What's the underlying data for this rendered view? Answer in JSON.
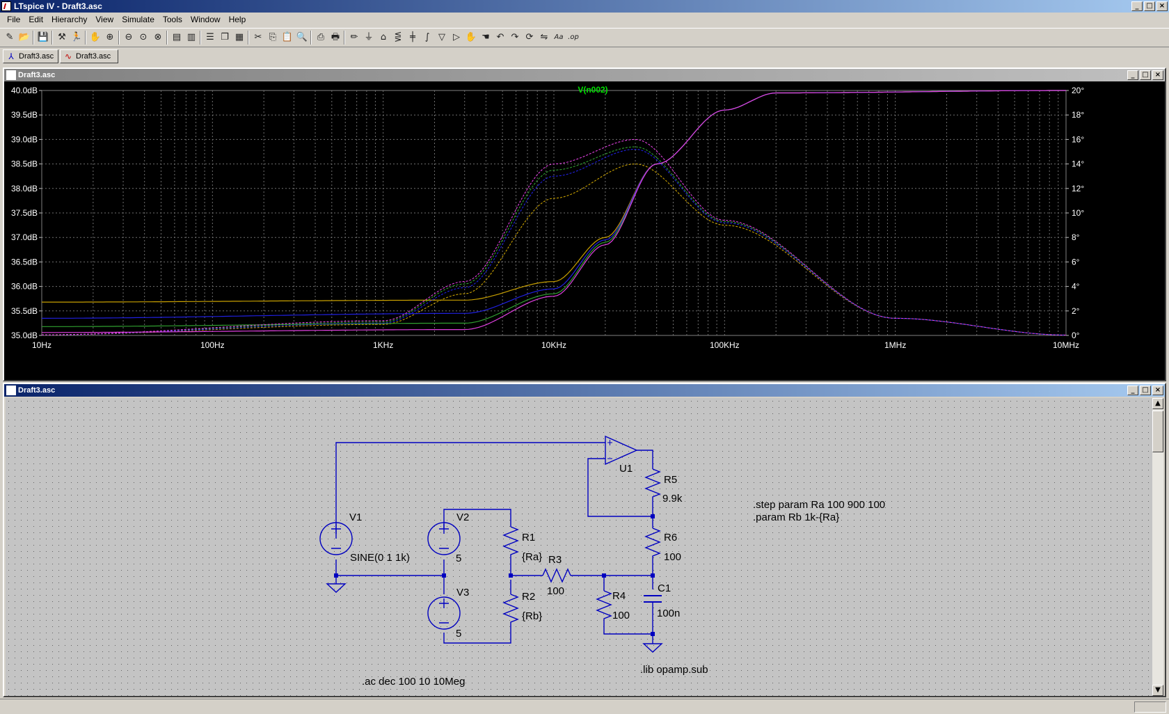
{
  "window": {
    "title": "LTspice IV - Draft3.asc"
  },
  "menu": [
    "File",
    "Edit",
    "Hierarchy",
    "View",
    "Simulate",
    "Tools",
    "Window",
    "Help"
  ],
  "toolbar": [
    "new-schematic-icon",
    "open-icon",
    "save-icon",
    "control-panel-icon",
    "run-icon",
    "halt-icon",
    "zoom-in-icon",
    "zoom-out-icon",
    "zoom-fit-icon",
    "zoom-cancel-icon",
    "autorange-icon",
    "pick-visible-traces-icon",
    "tile-horizontal-icon",
    "cascade-icon",
    "tile-vertical-icon",
    "cut-icon",
    "copy-icon",
    "paste-icon",
    "find-icon",
    "print-setup-icon",
    "print-icon",
    "wire-icon",
    "ground-icon",
    "label-icon",
    "resistor-icon",
    "capacitor-icon",
    "inductor-icon",
    "diode-icon",
    "component-icon",
    "move-icon",
    "drag-icon",
    "undo-icon",
    "redo-icon",
    "rotate-icon",
    "mirror-icon",
    "text-icon",
    "spice-directive-icon"
  ],
  "tabs": [
    {
      "label": "Draft3.asc",
      "icon": "schematic-icon"
    },
    {
      "label": "Draft3.asc",
      "icon": "waveform-icon"
    }
  ],
  "waveform_window": {
    "title": "Draft3.asc"
  },
  "schematic_window": {
    "title": "Draft3.asc"
  },
  "chart_data": {
    "type": "line",
    "title": "V(n002)",
    "x_scale": "log",
    "xlim": [
      10,
      10000000
    ],
    "x_ticks": [
      "10Hz",
      "100Hz",
      "1KHz",
      "10KHz",
      "100KHz",
      "1MHz",
      "10MHz"
    ],
    "ylim": [
      35.0,
      40.0
    ],
    "y_ticks": [
      "35.0dB",
      "35.5dB",
      "36.0dB",
      "36.5dB",
      "37.0dB",
      "37.5dB",
      "38.0dB",
      "38.5dB",
      "39.0dB",
      "39.5dB",
      "40.0dB"
    ],
    "y2lim": [
      0,
      20
    ],
    "y2_ticks": [
      "0°",
      "2°",
      "4°",
      "6°",
      "8°",
      "10°",
      "12°",
      "14°",
      "16°",
      "18°",
      "20°"
    ],
    "grid": true,
    "series": [
      {
        "color": "#c8a000",
        "magnitude": [
          [
            10,
            35.68
          ],
          [
            3000,
            35.72
          ],
          [
            10000,
            36.1
          ],
          [
            20000,
            37.0
          ],
          [
            40000,
            38.5
          ],
          [
            100000,
            39.6
          ],
          [
            200000,
            39.95
          ],
          [
            10000000,
            40.0
          ]
        ],
        "phase": [
          [
            10,
            0.05
          ],
          [
            1000,
            0.9
          ],
          [
            3000,
            3.4
          ],
          [
            10000,
            11.2
          ],
          [
            30000,
            14.0
          ],
          [
            100000,
            9.0
          ],
          [
            1000000,
            1.4
          ],
          [
            10000000,
            0.03
          ]
        ]
      },
      {
        "color": "#30a030",
        "magnitude": [
          [
            10,
            35.18
          ],
          [
            3000,
            35.25
          ],
          [
            10000,
            35.85
          ],
          [
            20000,
            36.9
          ],
          [
            40000,
            38.5
          ],
          [
            100000,
            39.6
          ],
          [
            200000,
            39.95
          ],
          [
            10000000,
            40.0
          ]
        ],
        "phase": [
          [
            10,
            0.05
          ],
          [
            1000,
            1.1
          ],
          [
            3000,
            4.2
          ],
          [
            10000,
            13.5
          ],
          [
            30000,
            15.4
          ],
          [
            100000,
            9.3
          ],
          [
            1000000,
            1.4
          ],
          [
            10000000,
            0.03
          ]
        ]
      },
      {
        "color": "#2020e0",
        "magnitude": [
          [
            10,
            35.35
          ],
          [
            3000,
            35.45
          ],
          [
            10000,
            35.95
          ],
          [
            20000,
            36.95
          ],
          [
            40000,
            38.5
          ],
          [
            100000,
            39.6
          ],
          [
            200000,
            39.95
          ],
          [
            10000000,
            40.0
          ]
        ],
        "phase": [
          [
            10,
            0.05
          ],
          [
            1000,
            1.0
          ],
          [
            3000,
            3.9
          ],
          [
            10000,
            13.0
          ],
          [
            30000,
            15.2
          ],
          [
            100000,
            9.2
          ],
          [
            1000000,
            1.4
          ],
          [
            10000000,
            0.03
          ]
        ]
      },
      {
        "color": "#e040e0",
        "magnitude": [
          [
            10,
            35.06
          ],
          [
            3000,
            35.12
          ],
          [
            10000,
            35.8
          ],
          [
            20000,
            36.85
          ],
          [
            40000,
            38.5
          ],
          [
            100000,
            39.6
          ],
          [
            200000,
            39.95
          ],
          [
            10000000,
            40.0
          ]
        ],
        "phase": [
          [
            10,
            0.05
          ],
          [
            1000,
            1.2
          ],
          [
            3000,
            4.4
          ],
          [
            10000,
            14.0
          ],
          [
            30000,
            16.0
          ],
          [
            100000,
            9.4
          ],
          [
            1000000,
            1.4
          ],
          [
            10000000,
            0.03
          ]
        ]
      }
    ]
  },
  "schematic": {
    "labels": {
      "v1": "V1",
      "v1_value": "SINE(0 1 1k)",
      "v2": "V2",
      "v2_value": "5",
      "v3": "V3",
      "v3_value": "5",
      "r1": "R1",
      "r1_value": "{Ra}",
      "r2": "R2",
      "r2_value": "{Rb}",
      "r3": "R3",
      "r3_value": "100",
      "r4": "R4",
      "r4_value": "100",
      "r5": "R5",
      "r5_value": "9.9k",
      "r6": "R6",
      "r6_value": "100",
      "c1": "C1",
      "c1_value": "100n",
      "u1": "U1"
    },
    "directives": {
      "step": ".step param Ra 100 900 100",
      "param": ".param Rb 1k-{Ra}",
      "ac": ".ac dec 100 10 10Meg",
      "lib": ".lib opamp.sub"
    }
  }
}
